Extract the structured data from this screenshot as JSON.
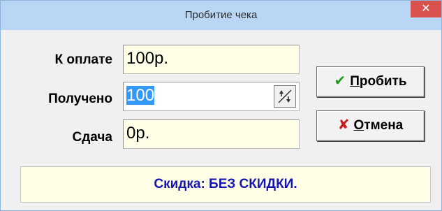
{
  "window": {
    "title": "Пробитие чека",
    "close_glyph": "✕"
  },
  "form": {
    "to_pay_label": "К оплате",
    "to_pay_value": "100р.",
    "received_label": "Получено",
    "received_value": "100",
    "change_label": "Сдача",
    "change_value": "0р."
  },
  "buttons": {
    "ok_icon": "✔",
    "ok_mnemonic": "П",
    "ok_rest": "робить",
    "cancel_icon": "✘",
    "cancel_mnemonic": "О",
    "cancel_rest": "тмена"
  },
  "discount": {
    "text": "Скидка: БЕЗ СКИДКИ."
  },
  "icons": {
    "ok": "checkmark-icon",
    "cancel": "cross-icon",
    "spinner": "spin-arrows-icon",
    "close": "close-icon"
  },
  "colors": {
    "titlebar": "#b9d7f4",
    "close_button": "#d9524d",
    "field_background": "#ffffe8",
    "selection": "#3399ff",
    "discount_text": "#1414b4",
    "ok_icon": "#1e9a1e",
    "cancel_icon": "#c81e1e"
  }
}
